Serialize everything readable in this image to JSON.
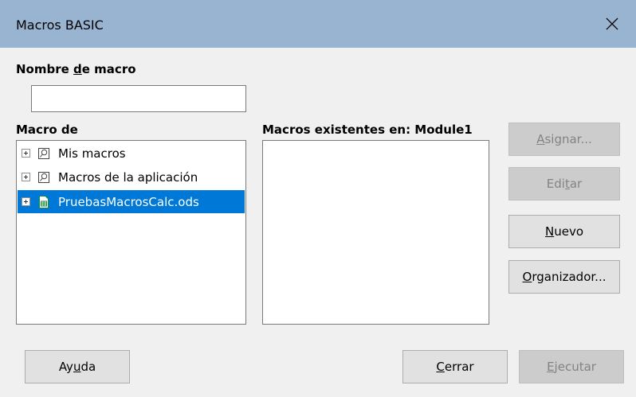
{
  "window": {
    "title": "Macros BASIC",
    "titlebar_color": "#99b4d1"
  },
  "macro_name": {
    "label_pre": "Nombre ",
    "label_mnemonic": "d",
    "label_post": "e macro",
    "value": ""
  },
  "macro_from": {
    "label": "Macro de",
    "items": [
      {
        "label": "Mis macros",
        "icon": "macro-library-icon",
        "selected": false
      },
      {
        "label": "Macros de la aplicación",
        "icon": "macro-library-icon",
        "selected": false
      },
      {
        "label": "PruebasMacrosCalc.ods",
        "icon": "spreadsheet-document-icon",
        "selected": true
      }
    ]
  },
  "existing_macros": {
    "label": "Macros existentes en: Module1",
    "items": []
  },
  "buttons": {
    "assign": {
      "pre": "",
      "mnemonic": "A",
      "post": "signar...",
      "enabled": false
    },
    "edit": {
      "pre": "Edi",
      "mnemonic": "t",
      "post": "ar",
      "enabled": false
    },
    "new": {
      "pre": "",
      "mnemonic": "N",
      "post": "uevo",
      "enabled": true
    },
    "organizer": {
      "pre": "",
      "mnemonic": "O",
      "post": "rganizador...",
      "enabled": true
    },
    "help": {
      "pre": "Ay",
      "mnemonic": "u",
      "post": "da",
      "enabled": true
    },
    "close": {
      "pre": "",
      "mnemonic": "C",
      "post": "errar",
      "enabled": true
    },
    "run": {
      "pre": "",
      "mnemonic": "E",
      "post": "jecutar",
      "enabled": false
    }
  },
  "colors": {
    "selection": "#0078d7",
    "dialog_background": "#f0f0f0"
  }
}
